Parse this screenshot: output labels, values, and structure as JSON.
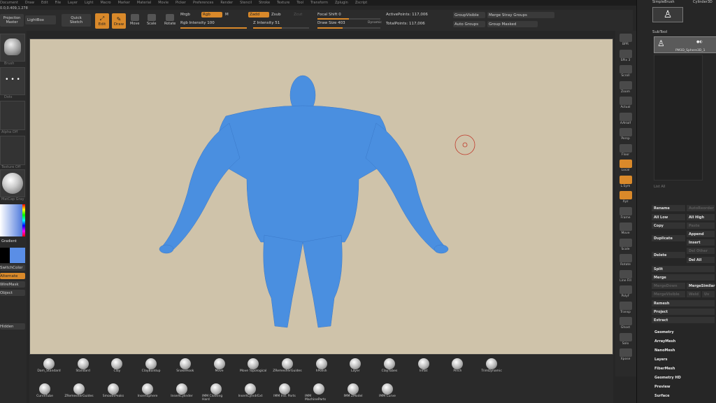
{
  "menubar": [
    "Document",
    "Draw",
    "Edit",
    "File",
    "Layer",
    "Light",
    "Macro",
    "Marker",
    "Material",
    "Movie",
    "Picker",
    "Preferences",
    "Render",
    "Stencil",
    "Stroke",
    "Texture",
    "Tool",
    "Transform",
    "Zplugin",
    "Zscript"
  ],
  "coords": "0.0,0.409,1.278",
  "topbar": {
    "projection_master": "Projection\nMaster",
    "lightbox": "LightBox",
    "quick_sketch": "Quick\nSketch",
    "edit": "Edit",
    "draw": "Draw",
    "move": "Move",
    "scale": "Scale",
    "rotate": "Rotate",
    "mrgb": "Mrgb",
    "rgb": "Rgb",
    "m": "M",
    "rgb_intensity": "Rgb Intensity 100",
    "zadd": "Zadd",
    "zsub": "Zsub",
    "zcut": "Zcut",
    "z_intensity": "Z Intensity 51",
    "focal_shift": "Focal Shift 0",
    "draw_size": "Draw Size 403",
    "dynamic": "Dynamic",
    "active_points": "ActivePoints: 117,006",
    "total_points": "TotalPoints: 117,006",
    "group_visible": "GroupVisible",
    "merge_stray": "Merge Stray Groups",
    "auto_groups": "Auto Groups",
    "group_masked": "Group Masked",
    "rgb_intensity_level": 1.0,
    "z_intensity_level": 0.51,
    "focal_shift_level": 0.5,
    "draw_size_level": 0.4
  },
  "left_shelf": {
    "labels": [
      "Brush",
      "Dots",
      "Alpha Off",
      "Texture Off",
      "MatCap Gray",
      "Gradient",
      "SwitchColor",
      "Alternate",
      "WireMask",
      "Object",
      "Hidden"
    ]
  },
  "right_shelf": [
    "BPR",
    "SPix 3",
    "Scroll",
    "Zoom",
    "Actual",
    "AAHalf",
    "Persp",
    "Floor",
    "Local",
    "L.Sym",
    "Xyz",
    "Frame",
    "Move",
    "Scale",
    "Rotate",
    "Line Fill",
    "PolyF",
    "Transp",
    "Ghost",
    "Solo",
    "Xpose"
  ],
  "rpanel": {
    "top_items": [
      "SimpleBrush",
      "Cylinder3D"
    ],
    "subtool_header": "SubTool",
    "subtool_name": "PM3D_Sphere3D_1",
    "list_all": "List All",
    "rename": "Rename",
    "autoreorder": "AutoReorder",
    "all_low": "All Low",
    "all_high": "All High",
    "copy": "Copy",
    "paste": "Paste",
    "duplicate": "Duplicate",
    "append": "Append",
    "insert": "Insert",
    "delete": "Delete",
    "del_other": "Del Other",
    "del_all": "Del All",
    "split": "Split",
    "merge": "Merge",
    "merge_down": "MergeDown",
    "merge_similar": "MergeSimilar",
    "merge_visible": "MergeVisible",
    "weld": "Weld",
    "uv": "Uv",
    "remesh": "Remesh",
    "project": "Project",
    "extract": "Extract",
    "sections": [
      "Geometry",
      "ArrayMesh",
      "NanoMesh",
      "Layers",
      "FiberMesh",
      "Geometry HD",
      "Preview",
      "Surface"
    ]
  },
  "bottom": {
    "row1": [
      "Dam_Standard",
      "Standard",
      "Clay",
      "ClayBuildup",
      "SnakeHook",
      "Move",
      "Move Topological",
      "ZRemesherGuides",
      "hPolish",
      "Layer",
      "ClayTubes",
      "Inflat",
      "Pinch",
      "TrimDynamic"
    ],
    "row2": [
      "CurveTube",
      "ZRemesherGuides",
      "SmoothPeaks",
      "InsertSphere",
      "InsertCylinder",
      "IMM Clothing Hard",
      "InsertCylndrExt",
      "IMM Ind. Parts",
      "IMM MachineParts",
      "IMM ZModel",
      "IMM Curve"
    ]
  },
  "colors": {
    "accent": "#d9892a",
    "mesh": "#4a8fe0",
    "canvas": "#cfc3aa"
  }
}
